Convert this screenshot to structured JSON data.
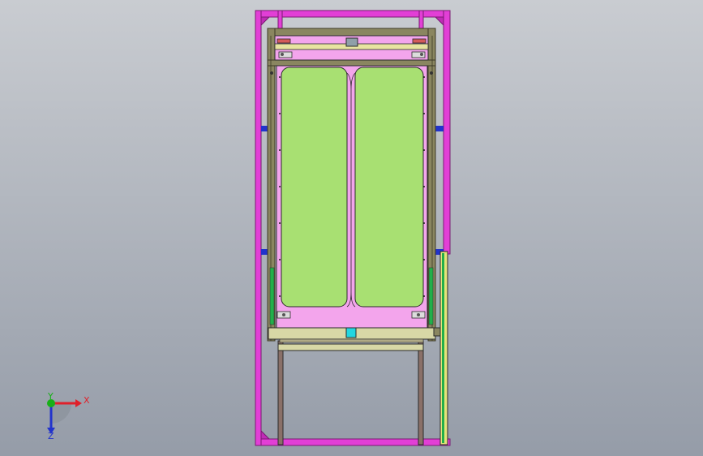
{
  "viewport": {
    "view": "front",
    "background_top": "#c9ccd1",
    "background_bottom": "#959ca8"
  },
  "colors": {
    "outer_frame": "#e23fd6",
    "outer_frame_edge": "#7a1a72",
    "inner_frame": "#8a8660",
    "inner_frame_edge": "#3d3a26",
    "panel_magenta": "#f3a5ec",
    "panel_green": "#a8e072",
    "edge_line": "#2b2b2b",
    "bracket_blue": "#2233cc",
    "rail_yellow": "#e4e47a",
    "rail_green": "#22b04a",
    "handle_cyan": "#22d6e0",
    "beam_olive": "#d8d8a6"
  },
  "triad": {
    "x_label": "X",
    "y_label": "Y",
    "z_label": "Z",
    "x_color": "#e0202a",
    "y_color": "#18b018",
    "z_color": "#2233cc"
  }
}
